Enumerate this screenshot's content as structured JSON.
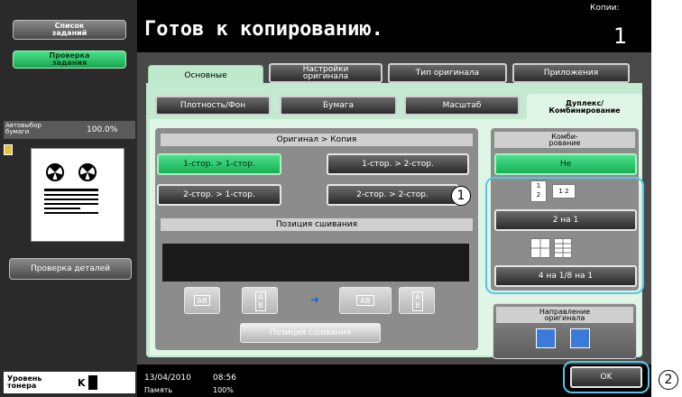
{
  "sidebar": {
    "job_list": "Список\nзаданий",
    "job_check": "Проверка\nзадания",
    "auto_paper_label": "Автовыбор\nбумаги",
    "zoom": "100.0%",
    "detail_check": "Проверка деталей",
    "toner_label": "Уровень\nтонера",
    "toner_letter": "K"
  },
  "header": {
    "title": "Готов к копированию.",
    "copies_label": "Копии:",
    "copies_value": "1"
  },
  "tabs": [
    {
      "label": "Основные"
    },
    {
      "label": "Настройки\nоригинала"
    },
    {
      "label": "Тип оригинала"
    },
    {
      "label": "Приложения"
    }
  ],
  "subtabs": [
    {
      "label": "Плотность/Фон"
    },
    {
      "label": "Бумага"
    },
    {
      "label": "Масштаб"
    },
    {
      "label": "Дуплекс/\nКомбинирование"
    }
  ],
  "duplex": {
    "header": "Оригинал > Копия",
    "options": [
      "1-стор. > 1-стор.",
      "1-стор. > 2-стор.",
      "2-стор. > 1-стор.",
      "2-стор. > 2-стор."
    ],
    "binding_header": "Позиция сшивания",
    "binding_button": "Позиция сшивания"
  },
  "combine": {
    "header": "Комби-\nрование",
    "none": "Не",
    "two_in_one": "2 на 1",
    "four_eight": "4 на 1/8 на 1"
  },
  "orientation": {
    "header": "Направление\nоригинала"
  },
  "status": {
    "date": "13/04/2010",
    "time": "08:56",
    "memory_label": "Память",
    "memory_value": "100%"
  },
  "ok_label": "OK",
  "callouts": [
    "1",
    "2"
  ]
}
